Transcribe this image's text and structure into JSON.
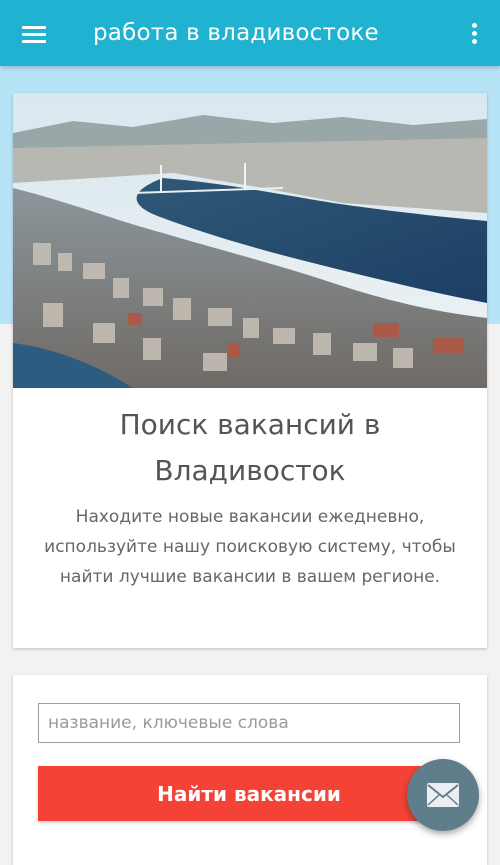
{
  "appbar": {
    "title": "работа в владивостоке",
    "menu_icon": "hamburger-menu-icon",
    "overflow_icon": "more-vert-icon",
    "background_color": "#1fb3d1"
  },
  "hero": {
    "image_alt": "Владивосток",
    "title": "Поиск вакансий в Владивосток",
    "description": "Находите новые вакансии ежедневно, используйте нашу поисковую систему, чтобы найти лучшие вакансии в вашем регионе."
  },
  "search": {
    "placeholder": "название, ключевые слова",
    "value": "",
    "button_label": "Найти вакансии",
    "button_color": "#f44336"
  },
  "fab": {
    "icon": "mail-envelope-icon",
    "color": "#607d8b"
  }
}
